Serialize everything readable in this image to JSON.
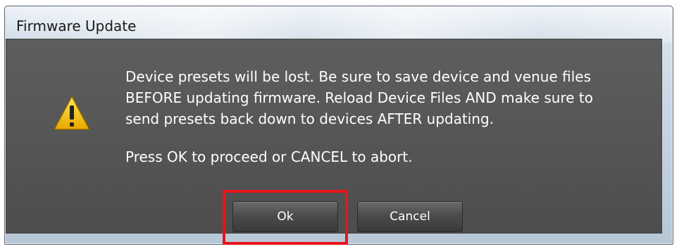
{
  "window": {
    "title": "Firmware Update"
  },
  "dialog": {
    "icon": "warning-triangle-icon",
    "message_line_1": "Device presets will be lost. Be sure to save device and venue files",
    "message_line_2": "BEFORE updating firmware. Reload Device Files AND make sure to",
    "message_line_3": "send presets back down to devices AFTER updating.",
    "message_line_4": "Press OK to proceed or CANCEL to abort."
  },
  "buttons": {
    "ok_label": "Ok",
    "cancel_label": "Cancel"
  },
  "colors": {
    "highlight": "#e8141c",
    "dialog_background": "#555555",
    "warning_fill": "#f2c21b"
  }
}
